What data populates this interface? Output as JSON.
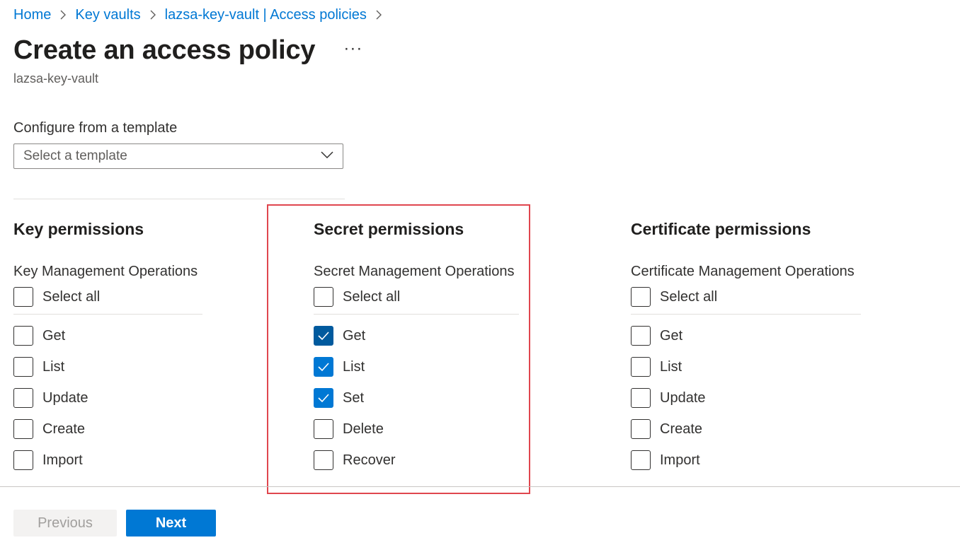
{
  "breadcrumb": [
    "Home",
    "Key vaults",
    "lazsa-key-vault | Access policies"
  ],
  "page": {
    "title": "Create an access policy",
    "more_label": "···",
    "subtitle": "lazsa-key-vault"
  },
  "template": {
    "label": "Configure from a template",
    "placeholder": "Select a template"
  },
  "columns": {
    "key": {
      "title": "Key permissions",
      "subtitle": "Key Management Operations",
      "select_all": "Select all",
      "items": [
        {
          "label": "Get",
          "checked": false
        },
        {
          "label": "List",
          "checked": false
        },
        {
          "label": "Update",
          "checked": false
        },
        {
          "label": "Create",
          "checked": false
        },
        {
          "label": "Import",
          "checked": false
        }
      ]
    },
    "secret": {
      "title": "Secret permissions",
      "subtitle": "Secret Management Operations",
      "select_all": "Select all",
      "items": [
        {
          "label": "Get",
          "checked": true
        },
        {
          "label": "List",
          "checked": true
        },
        {
          "label": "Set",
          "checked": true
        },
        {
          "label": "Delete",
          "checked": false
        },
        {
          "label": "Recover",
          "checked": false
        }
      ]
    },
    "certificate": {
      "title": "Certificate permissions",
      "subtitle": "Certificate Management Operations",
      "select_all": "Select all",
      "items": [
        {
          "label": "Get",
          "checked": false
        },
        {
          "label": "List",
          "checked": false
        },
        {
          "label": "Update",
          "checked": false
        },
        {
          "label": "Create",
          "checked": false
        },
        {
          "label": "Import",
          "checked": false
        }
      ]
    }
  },
  "footer": {
    "previous_label": "Previous",
    "next_label": "Next"
  },
  "colors": {
    "accent": "#0078d4",
    "highlight": "#e0464e"
  }
}
